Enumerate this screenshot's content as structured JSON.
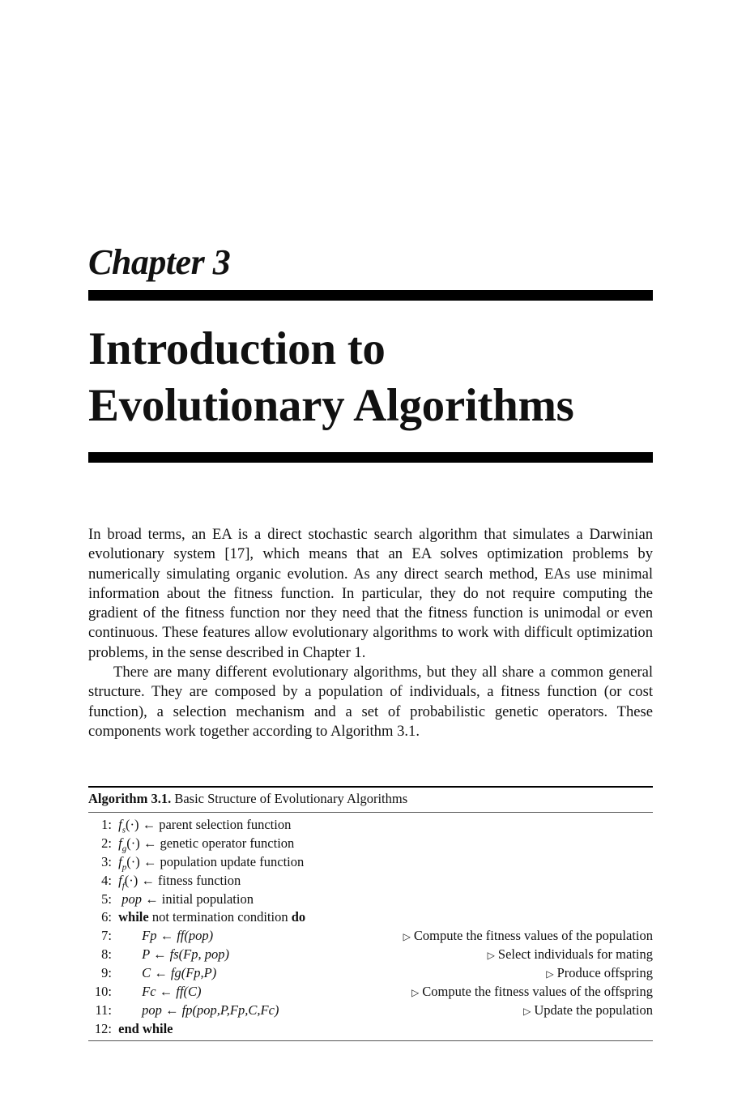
{
  "chapter": {
    "label": "Chapter 3",
    "title_lines": [
      "Introduction to",
      "Evolutionary Algorithms"
    ]
  },
  "body": {
    "paragraphs": [
      "In broad terms, an EA is a direct stochastic search algorithm that simulates a Darwinian evolutionary system [17], which means that an EA solves optimization problems by numerically simulating organic evolution. As any direct search method, EAs use minimal information about the fitness function. In particular, they do not require computing the gradient of the fitness function nor they need that the fitness function is unimodal or even continuous. These features allow evolutionary algorithms to work with difficult optimization problems, in the sense described in Chapter 1.",
      "There are many different evolutionary algorithms, but they all share a common general structure. They are composed by a population of individuals, a fitness function (or cost function), a selection mechanism and a set of probabilistic genetic operators. These components work together according to Algorithm 3.1."
    ]
  },
  "algorithm": {
    "caption_label": "Algorithm 3.1.",
    "caption_text": "Basic Structure of Evolutionary Algorithms",
    "comment_marker": "▷",
    "lines": [
      {
        "num": "1:",
        "math": "fs(·)",
        "arrow": "←",
        "text": "parent selection function",
        "comment": ""
      },
      {
        "num": "2:",
        "math": "fg(·)",
        "arrow": "←",
        "text": "genetic operator function",
        "comment": ""
      },
      {
        "num": "3:",
        "math": "fp(·)",
        "arrow": "←",
        "text": "population update function",
        "comment": ""
      },
      {
        "num": "4:",
        "math": "ff(·)",
        "arrow": "←",
        "text": "fitness function",
        "comment": ""
      },
      {
        "num": "5:",
        "math": "pop",
        "arrow": "←",
        "text": "initial population",
        "comment": ""
      },
      {
        "num": "6:",
        "kw1": "while",
        "text": "not termination condition",
        "kw2": "do",
        "comment": ""
      },
      {
        "num": "7:",
        "code": "Fp ← ff(pop)",
        "comment": "Compute the fitness values of the population"
      },
      {
        "num": "8:",
        "code": "P ← fs(Fp, pop)",
        "comment": "Select individuals for mating"
      },
      {
        "num": "9:",
        "code": "C ← fg(Fp,P)",
        "comment": "Produce offspring"
      },
      {
        "num": "10:",
        "code": "Fc ← ff(C)",
        "comment": "Compute the fitness values of the offspring"
      },
      {
        "num": "11:",
        "code": "pop ← fp(pop,P,Fp,C,Fc)",
        "comment": "Update the population"
      },
      {
        "num": "12:",
        "kw1": "end while",
        "comment": ""
      }
    ]
  }
}
